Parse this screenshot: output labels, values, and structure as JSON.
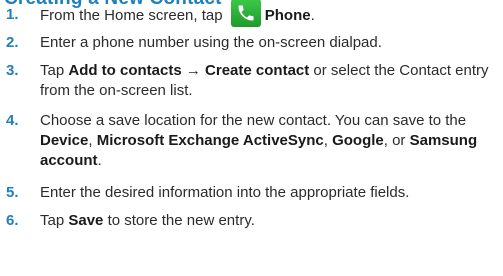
{
  "heading": "Creating a New Contact",
  "steps": [
    {
      "number": "1.",
      "parts": [
        "From the Home screen, tap ",
        "",
        "Phone",
        "."
      ]
    },
    {
      "number": "2.",
      "parts": [
        "Enter a phone number using the on-screen dialpad."
      ]
    },
    {
      "number": "3.",
      "parts": [
        "Tap ",
        "Add to contacts",
        " → ",
        "Create contact",
        " or select the Contact entry from the on-screen list."
      ]
    },
    {
      "number": "4.",
      "parts": [
        "Choose a save location for the new contact. You can save to the ",
        "Device",
        ", ",
        "Microsoft Exchange ActiveSync",
        ", ",
        "Google",
        ", or ",
        "Samsung account",
        "."
      ]
    },
    {
      "number": "5.",
      "parts": [
        "Enter the desired information into the appropriate fields."
      ]
    },
    {
      "number": "6.",
      "parts": [
        "Tap ",
        "Save",
        " to store the new entry."
      ]
    }
  ],
  "icons": {
    "phone": "phone-icon"
  },
  "colors": {
    "accent": "#1f7fc0",
    "phone_icon": "#2aae3a"
  }
}
